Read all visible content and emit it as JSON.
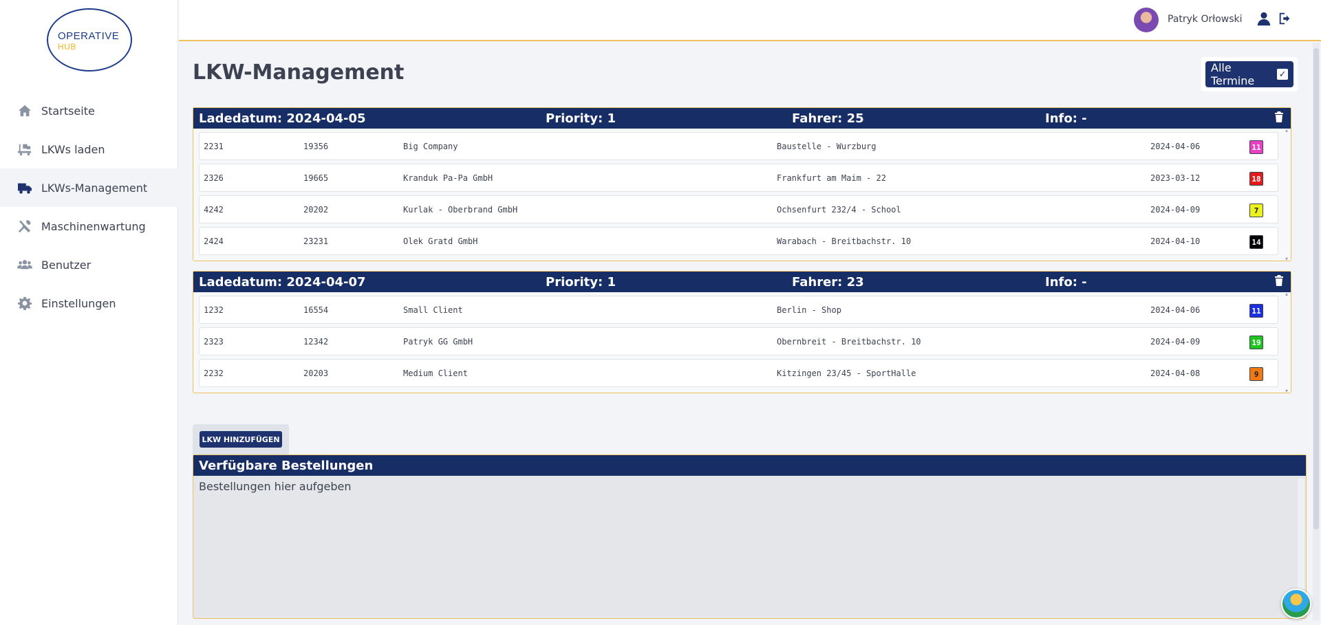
{
  "logo": {
    "line1": "OPERATIVE",
    "line2": "HUB"
  },
  "nav": [
    {
      "label": "Startseite",
      "icon": "home-icon"
    },
    {
      "label": "LKWs laden",
      "icon": "truck-loading-icon"
    },
    {
      "label": "LKWs-Management",
      "icon": "truck-icon",
      "active": true
    },
    {
      "label": "Maschinenwartung",
      "icon": "tools-icon"
    },
    {
      "label": "Benutzer",
      "icon": "users-icon"
    },
    {
      "label": "Einstellungen",
      "icon": "gear-icon"
    }
  ],
  "header": {
    "user_name": "Patryk Orłowski"
  },
  "page": {
    "title": "LKW-Management",
    "toggle_label": "Alle Termine",
    "toggle_checked": true
  },
  "trucks": [
    {
      "ladedatum": "Ladedatum: 2024-04-05",
      "priority": "Priority: 1",
      "fahrer": "Fahrer: 25",
      "info": "Info: -",
      "rows": [
        {
          "c1": "2231",
          "c2": "19356",
          "client": "Big Company",
          "address": "Baustelle - Wurzburg",
          "date": "2024-04-06",
          "badge": "11",
          "badge_color": "#e83fc3",
          "badge_text": "#ffffff"
        },
        {
          "c1": "2326",
          "c2": "19665",
          "client": "Kranduk Pa-Pa GmbH",
          "address": "Frankfurt am Maim - 22",
          "date": "2023-03-12",
          "badge": "18",
          "badge_color": "#e41b1b",
          "badge_text": "#ffffff"
        },
        {
          "c1": "4242",
          "c2": "20202",
          "client": "Kurlak - Oberbrand GmbH",
          "address": "Ochsenfurt 232/4 - School",
          "date": "2024-04-09",
          "badge": "7",
          "badge_color": "#ecf21e",
          "badge_text": "#1a1a1a"
        },
        {
          "c1": "2424",
          "c2": "23231",
          "client": "Olek Gratd GmbH",
          "address": "Warabach - Breitbachstr. 10",
          "date": "2024-04-10",
          "badge": "14",
          "badge_color": "#000000",
          "badge_text": "#ffffff"
        }
      ]
    },
    {
      "ladedatum": "Ladedatum: 2024-04-07",
      "priority": "Priority: 1",
      "fahrer": "Fahrer: 23",
      "info": "Info: -",
      "rows": [
        {
          "c1": "1232",
          "c2": "16554",
          "client": "Small Client",
          "address": "Berlin - Shop",
          "date": "2024-04-06",
          "badge": "11",
          "badge_color": "#1b2fe0",
          "badge_text": "#ffffff"
        },
        {
          "c1": "2323",
          "c2": "12342",
          "client": "Patryk GG GmbH",
          "address": "Obernbreit - Breitbachstr. 10",
          "date": "2024-04-09",
          "badge": "19",
          "badge_color": "#1fc41f",
          "badge_text": "#ffffff"
        },
        {
          "c1": "2232",
          "c2": "20203",
          "client": "Medium Client",
          "address": "Kitzingen 23/45 - SportHalle",
          "date": "2024-04-08",
          "badge": "9",
          "badge_color": "#f07a12",
          "badge_text": "#1a1a1a"
        }
      ]
    }
  ],
  "add_button": "LKW HINZUFÜGEN",
  "orders": {
    "title": "Verfügbare Bestellungen",
    "placeholder": "Bestellungen hier aufgeben"
  }
}
